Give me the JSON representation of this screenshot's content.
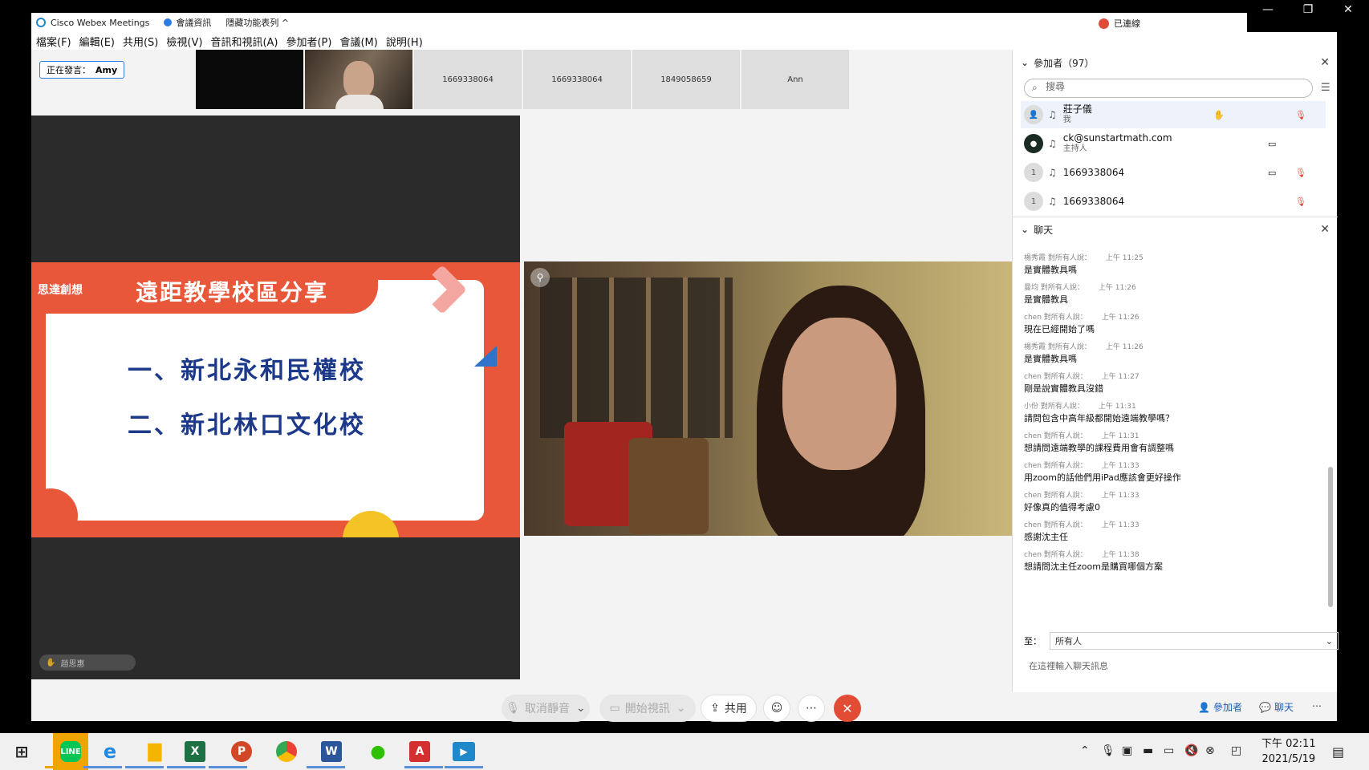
{
  "titlebar": {
    "app_name": "Cisco Webex Meetings",
    "meeting_info": "會議資訊",
    "hide_toolbar": "隱藏功能表列 ^",
    "status": "已連線",
    "minimize": "—",
    "restore": "❐",
    "close": "✕"
  },
  "menu": [
    "檔案(F)",
    "編輯(E)",
    "共用(S)",
    "檢視(V)",
    "音訊和視訊(A)",
    "參加者(P)",
    "會議(M)",
    "說明(H)"
  ],
  "stage": {
    "speaking_label": "正在發言：",
    "speaker": "Amy",
    "thumbnails": [
      "",
      "",
      "1669338064",
      "1669338064",
      "1849058659",
      "Ann"
    ],
    "raised_hand_name": "趙思惠"
  },
  "slide": {
    "brand": "思達創想",
    "title": "遠距教學校區分享",
    "line1": "一、新北永和民權校",
    "line2": "二、新北林口文化校"
  },
  "controls": {
    "mute": "取消靜音",
    "video": "開始視訊",
    "share": "共用",
    "participants": "參加者",
    "chat": "聊天"
  },
  "participants": {
    "header": "參加者（97）",
    "search_placeholder": "搜尋",
    "list": [
      {
        "name": "莊子儀",
        "role": "我",
        "avatar": ""
      },
      {
        "name": "ck@sunstartmath.com",
        "role": "主持人",
        "avatar": ""
      },
      {
        "name": "1669338064",
        "role": "",
        "avatar": "1"
      },
      {
        "name": "1669338064",
        "role": "",
        "avatar": "1"
      }
    ]
  },
  "chat": {
    "header": "聊天",
    "messages": [
      {
        "meta": "楊秀霞 對所有人說：",
        "time": "上午 11:25",
        "text": "是實體教具嗎"
      },
      {
        "meta": "曼均 對所有人說：",
        "time": "上午 11:26",
        "text": "是實體教具"
      },
      {
        "meta": "chen 對所有人說：",
        "time": "上午 11:26",
        "text": "現在已經開始了嗎"
      },
      {
        "meta": "楊秀霞 對所有人說：",
        "time": "上午 11:26",
        "text": "是實體教具嗎"
      },
      {
        "meta": "chen 對所有人說：",
        "time": "上午 11:27",
        "text": "剛是說實體教具沒錯"
      },
      {
        "meta": "小份 對所有人說：",
        "time": "上午 11:31",
        "text": "請問包含中高年級都開始遠端教學嗎？"
      },
      {
        "meta": "chen 對所有人說：",
        "time": "上午 11:31",
        "text": "想請問遠端教學的課程費用會有調整嗎"
      },
      {
        "meta": "chen 對所有人說：",
        "time": "上午 11:33",
        "text": "用zoom的話他們用iPad應該會更好操作"
      },
      {
        "meta": "chen 對所有人說：",
        "time": "上午 11:33",
        "text": "好像真的值得考慮0"
      },
      {
        "meta": "chen 對所有人說：",
        "time": "上午 11:33",
        "text": "感謝沈主任"
      },
      {
        "meta": "chen 對所有人說：",
        "time": "上午 11:38",
        "text": "想請問沈主任zoom是購買哪個方案"
      }
    ],
    "to_label": "至：",
    "to_value": "所有人",
    "input_placeholder": "在這裡輸入聊天訊息"
  },
  "taskbar": {
    "time": "下午 02:11",
    "date": "2021/5/19"
  },
  "colors": {
    "accent": "#2a7de1",
    "leave": "#e24c35",
    "slide_orange": "#e9573a",
    "slide_navy": "#1d3a8a"
  }
}
